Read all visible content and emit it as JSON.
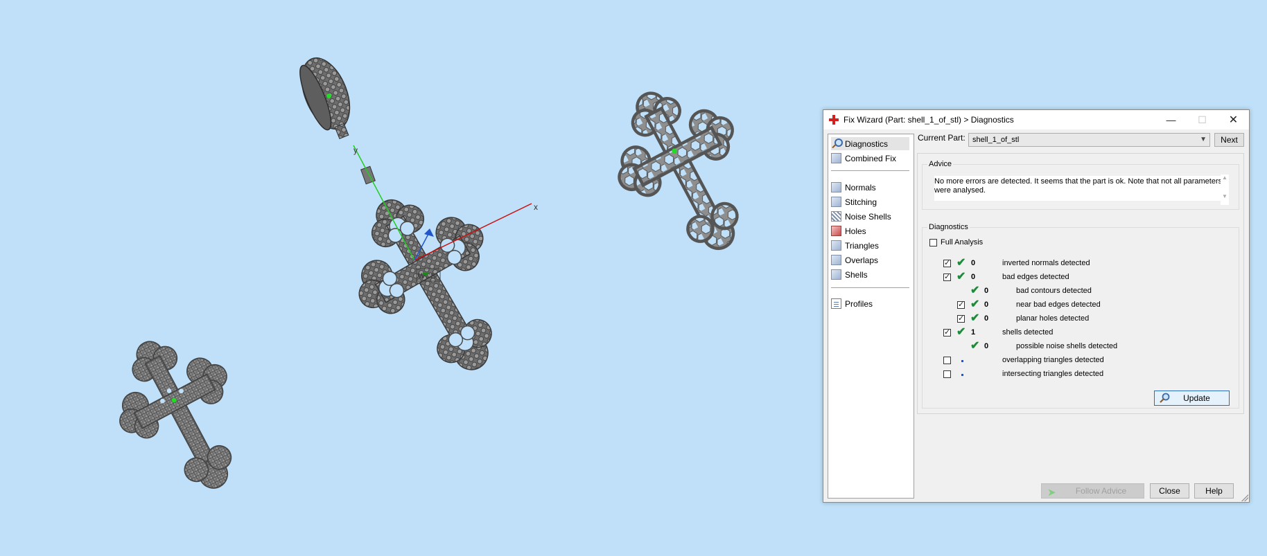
{
  "colors": {
    "viewport_bg": "#bfe0f8",
    "x_axis": "#cc1111",
    "y_axis": "#22cc22",
    "check_green": "#1f8a3a"
  },
  "viewport": {
    "axis_x_label": "x",
    "axis_y_label": "y",
    "wcs_label": "WCS"
  },
  "dialog": {
    "title": "Fix Wizard (Part: shell_1_of_stl) > Diagnostics",
    "nav": {
      "diagnostics": "Diagnostics",
      "combined_fix": "Combined Fix",
      "normals": "Normals",
      "stitching": "Stitching",
      "noise_shells": "Noise Shells",
      "holes": "Holes",
      "triangles": "Triangles",
      "overlaps": "Overlaps",
      "shells": "Shells",
      "profiles": "Profiles"
    },
    "current_part_label": "Current Part:",
    "current_part_value": "shell_1_of_stl",
    "next_label": "Next",
    "advice_title": "Advice",
    "advice_text": "No more errors are detected. It seems that the part is ok. Note that not all parameters were analysed.",
    "diagnostics_title": "Diagnostics",
    "full_analysis": "Full Analysis",
    "items": [
      {
        "count": "0",
        "label": "inverted normals detected"
      },
      {
        "count": "0",
        "label": "bad edges detected"
      },
      {
        "count": "0",
        "label": "bad contours detected"
      },
      {
        "count": "0",
        "label": "near bad edges detected"
      },
      {
        "count": "0",
        "label": "planar holes detected"
      },
      {
        "count": "1",
        "label": "shells detected"
      },
      {
        "count": "0",
        "label": "possible noise shells detected"
      },
      {
        "count": "",
        "label": "overlapping triangles detected"
      },
      {
        "count": "",
        "label": "intersecting triangles detected"
      }
    ],
    "update_label": "Update",
    "follow_advice_label": "Follow Advice",
    "close_label": "Close",
    "help_label": "Help"
  }
}
